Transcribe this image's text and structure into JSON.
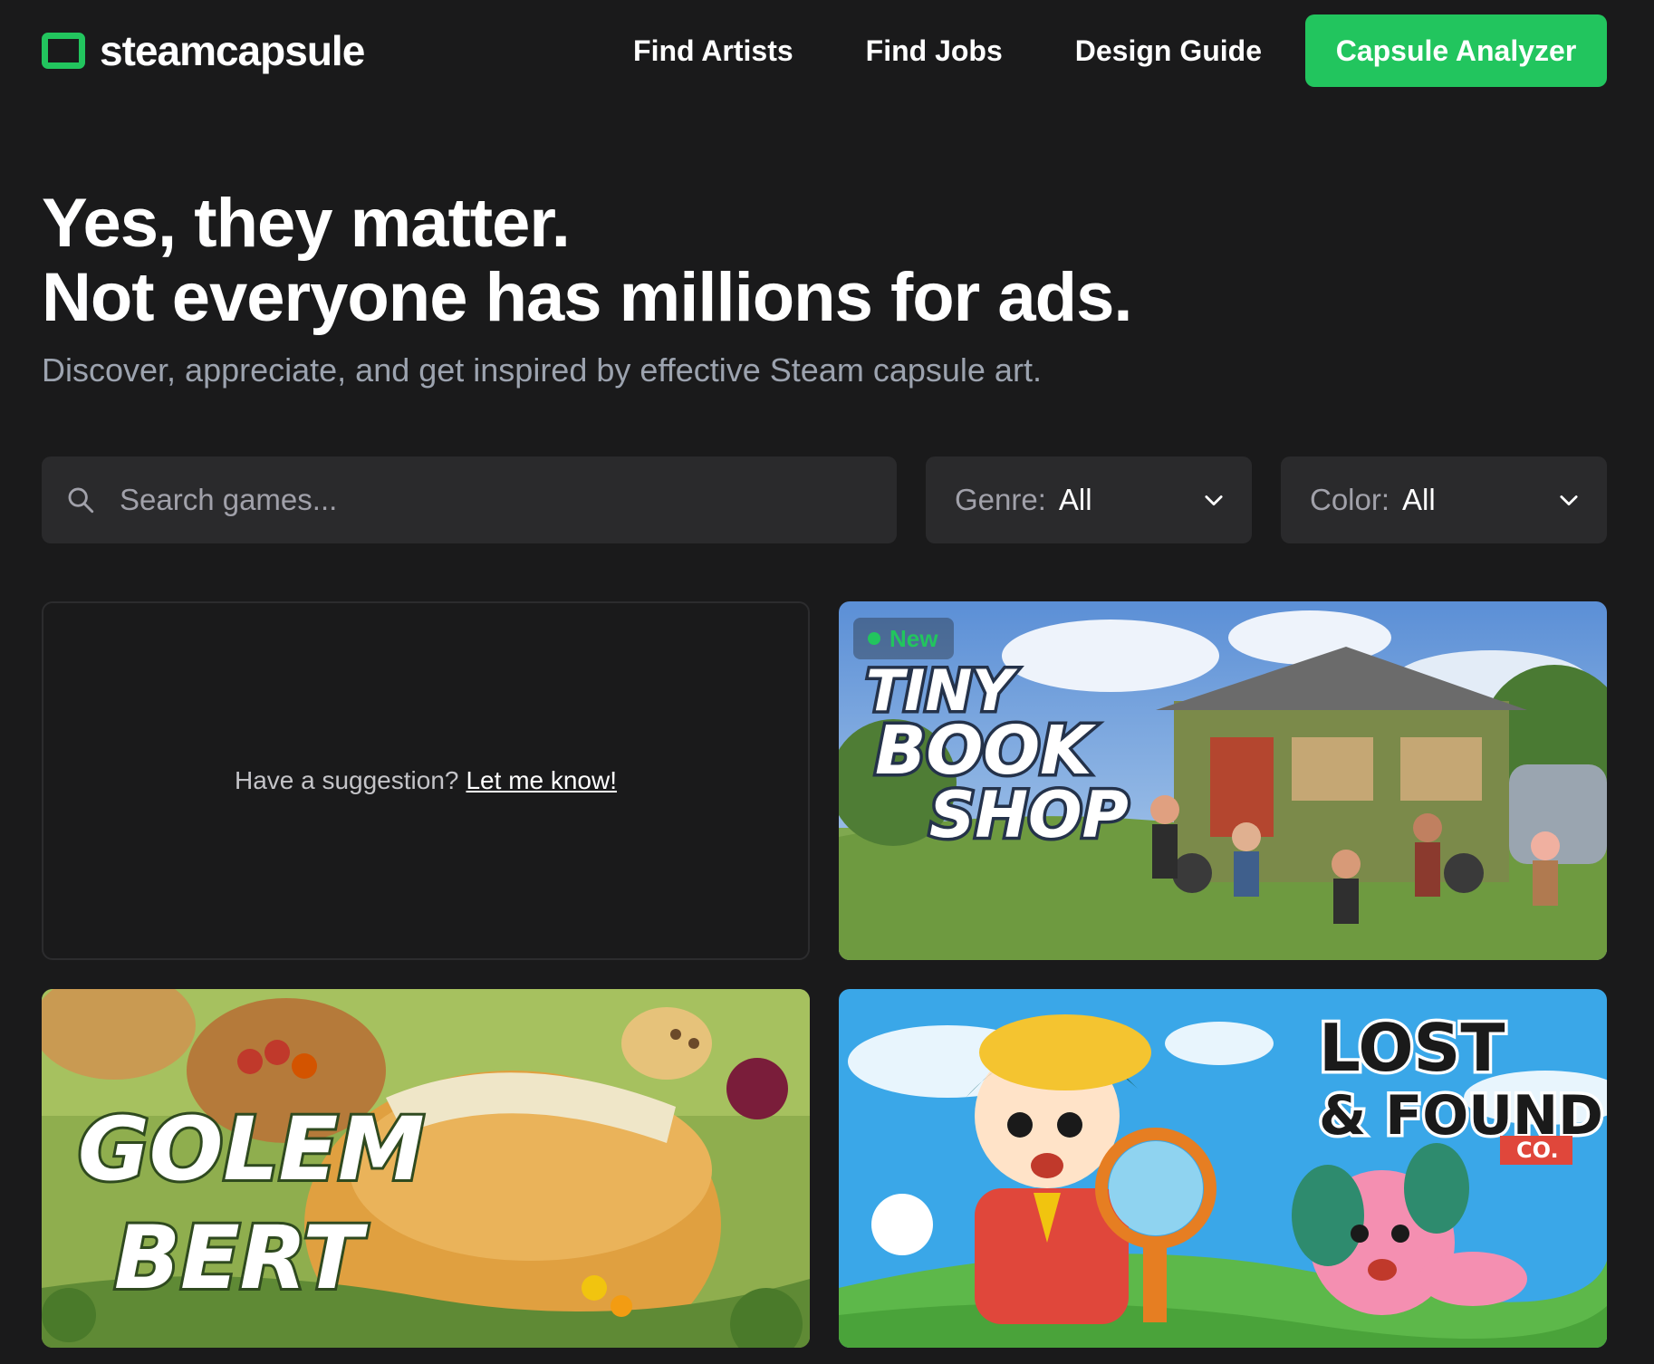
{
  "header": {
    "brand": "steamcapsule",
    "nav": [
      "Find Artists",
      "Find Jobs",
      "Design Guide"
    ],
    "cta": "Capsule Analyzer"
  },
  "hero": {
    "title_line1": "Yes, they matter.",
    "title_line2": "Not everyone has millions for ads.",
    "subtitle": "Discover, appreciate, and get inspired by effective Steam capsule art."
  },
  "filters": {
    "search_placeholder": "Search games...",
    "genre_label": "Genre:",
    "genre_value": "All",
    "color_label": "Color:",
    "color_value": "All"
  },
  "grid": {
    "suggestion_text": "Have a suggestion?",
    "suggestion_link": "Let me know!",
    "cards": [
      {
        "badge": "New",
        "logo_lines": [
          "TINY",
          "BOOK",
          "SHOP"
        ]
      },
      {
        "logo_lines": [
          "GOLEM",
          "BERT"
        ]
      },
      {
        "logo_lines": [
          "LOST",
          "& FOUND",
          "CO."
        ]
      }
    ]
  },
  "colors": {
    "background": "#1a1a1b",
    "accent": "#22c55e",
    "field": "#2a2a2c",
    "muted_text": "#9ca3af"
  },
  "icons": {
    "brand": "rounded-square-outline-icon",
    "search": "magnifier-icon",
    "dropdown": "chevron-down-icon"
  }
}
